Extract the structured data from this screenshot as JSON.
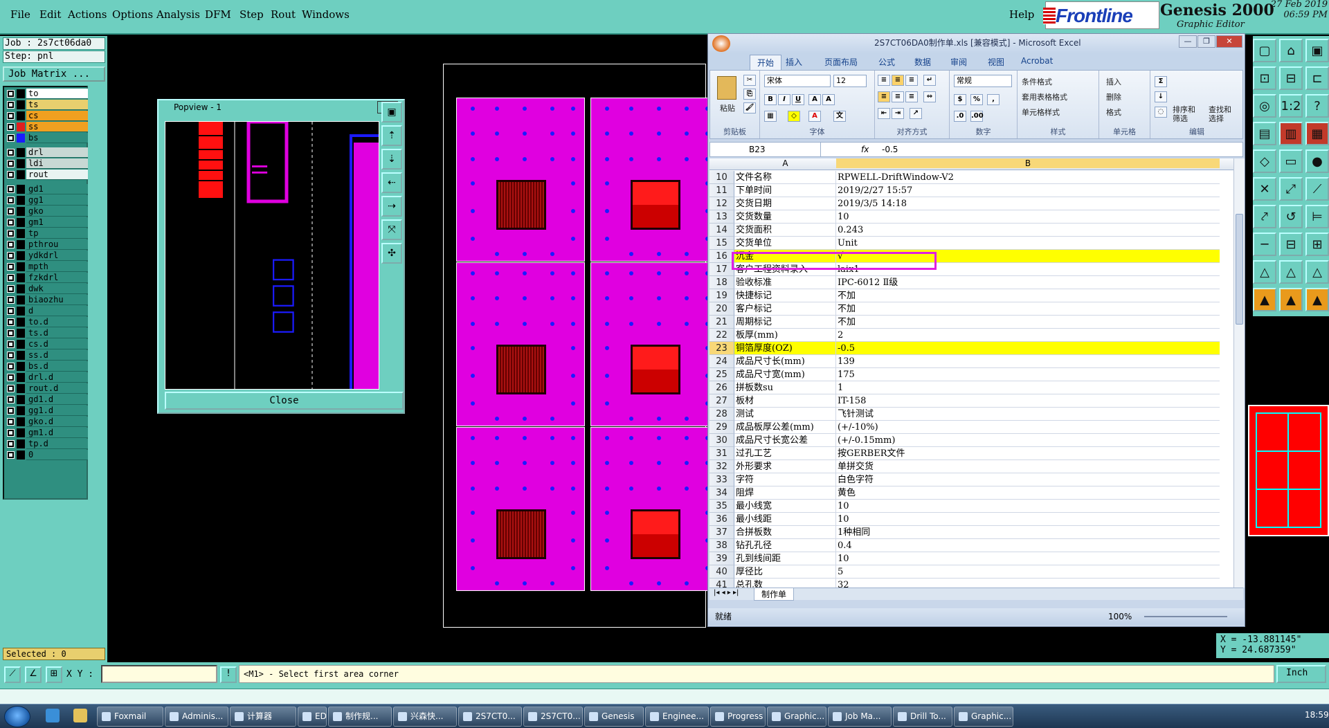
{
  "menu": {
    "items": [
      "File",
      "Edit",
      "Actions",
      "Options",
      "Analysis",
      "DFM",
      "Step",
      "Rout",
      "Windows"
    ],
    "help": "Help"
  },
  "branding": {
    "logo": "Frontline",
    "app_name": "Genesis 2000",
    "subtitle": "Graphic Editor",
    "date": "27 Feb 2019",
    "time": "06:59 PM"
  },
  "job": {
    "job_line": "Job : 2s7ct06da0",
    "step_line": "Step: pnl",
    "matrix_button": "Job Matrix ..."
  },
  "layers": [
    {
      "name": "to",
      "color": "#000000",
      "bg": "#ffffff"
    },
    {
      "name": "ts",
      "color": "#000000",
      "bg": "#e8cf6e"
    },
    {
      "name": "cs",
      "color": "#000000",
      "bg": "#f0a020"
    },
    {
      "name": "ss",
      "color": "#e02020",
      "bg": "#f0a020",
      "active": true
    },
    {
      "name": "bs",
      "color": "#1b1bff",
      "bg": "#2f8f80"
    },
    {
      "name": "drl",
      "color": "#000000",
      "bg": "#c8d8d4"
    },
    {
      "name": "ldi",
      "color": "#000000",
      "bg": "#c8d8d4"
    },
    {
      "name": "rout",
      "color": "#000000",
      "bg": "#e8f4f2"
    },
    {
      "name": "gd1",
      "color": "#000000",
      "bg": "#2f8f80"
    },
    {
      "name": "gg1",
      "color": "#000000",
      "bg": "#2f8f80"
    },
    {
      "name": "gko",
      "color": "#000000",
      "bg": "#2f8f80"
    },
    {
      "name": "gm1",
      "color": "#000000",
      "bg": "#2f8f80"
    },
    {
      "name": "tp",
      "color": "#000000",
      "bg": "#2f8f80"
    },
    {
      "name": "pthrou",
      "color": "#000000",
      "bg": "#2f8f80"
    },
    {
      "name": "ydkdrl",
      "color": "#000000",
      "bg": "#2f8f80"
    },
    {
      "name": "mpth",
      "color": "#000000",
      "bg": "#2f8f80"
    },
    {
      "name": "fzkdrl",
      "color": "#000000",
      "bg": "#2f8f80"
    },
    {
      "name": "dwk",
      "color": "#000000",
      "bg": "#2f8f80"
    },
    {
      "name": "biaozhu",
      "color": "#000000",
      "bg": "#2f8f80"
    },
    {
      "name": "d",
      "color": "#000000",
      "bg": "#2f8f80"
    },
    {
      "name": "to.d",
      "color": "#000000",
      "bg": "#2f8f80"
    },
    {
      "name": "ts.d",
      "color": "#000000",
      "bg": "#2f8f80"
    },
    {
      "name": "cs.d",
      "color": "#000000",
      "bg": "#2f8f80"
    },
    {
      "name": "ss.d",
      "color": "#000000",
      "bg": "#2f8f80"
    },
    {
      "name": "bs.d",
      "color": "#000000",
      "bg": "#2f8f80"
    },
    {
      "name": "drl.d",
      "color": "#000000",
      "bg": "#2f8f80"
    },
    {
      "name": "rout.d",
      "color": "#000000",
      "bg": "#2f8f80"
    },
    {
      "name": "gd1.d",
      "color": "#000000",
      "bg": "#2f8f80"
    },
    {
      "name": "gg1.d",
      "color": "#000000",
      "bg": "#2f8f80"
    },
    {
      "name": "gko.d",
      "color": "#000000",
      "bg": "#2f8f80"
    },
    {
      "name": "gm1.d",
      "color": "#000000",
      "bg": "#2f8f80"
    },
    {
      "name": "tp.d",
      "color": "#000000",
      "bg": "#2f8f80"
    },
    {
      "name": "0",
      "color": "#000000",
      "bg": "#2f8f80"
    }
  ],
  "selected": "Selected : 0",
  "popview": {
    "title": "Popview - 1",
    "close_x": "✕",
    "close_button": "Close"
  },
  "excel": {
    "title": "2S7CT06DA0制作单.xls [兼容模式] - Microsoft Excel",
    "tabs": [
      "开始",
      "插入",
      "页面布局",
      "公式",
      "数据",
      "审阅",
      "视图",
      "Acrobat"
    ],
    "ribbon": {
      "paste": "粘贴",
      "clipboard": "剪贴板",
      "font_name": "宋体",
      "font_size": "12",
      "font_group": "字体",
      "align_group": "对齐方式",
      "number_format": "常规",
      "number_group": "数字",
      "cond_format": "条件格式",
      "table_format": "套用表格格式",
      "cell_style": "单元格样式",
      "style_group": "样式",
      "insert": "插入",
      "delete": "删除",
      "format": "格式",
      "cells_group": "单元格",
      "sort": "排序和筛选",
      "find": "查找和选择",
      "edit_group": "编辑"
    },
    "namebox": "B23",
    "fx": "fx",
    "formula": "-0.5",
    "columns": [
      "A",
      "B"
    ],
    "rows": [
      {
        "n": "10",
        "a": "文件名称",
        "b": "RPWELL-DriftWindow-V2"
      },
      {
        "n": "11",
        "a": "下单时间",
        "b": "2019/2/27 15:57"
      },
      {
        "n": "12",
        "a": "交货日期",
        "b": "2019/3/5 14:18"
      },
      {
        "n": "13",
        "a": "交货数量",
        "b": "10"
      },
      {
        "n": "14",
        "a": "交货面积",
        "b": "0.243"
      },
      {
        "n": "15",
        "a": "交货单位",
        "b": "Unit"
      },
      {
        "n": "16",
        "a": "沉金",
        "b": "√",
        "yellow": true
      },
      {
        "n": "17",
        "a": "客户工程资料录入",
        "b": "laix1"
      },
      {
        "n": "18",
        "a": "验收标准",
        "b": "IPC-6012 Ⅱ级"
      },
      {
        "n": "19",
        "a": "快捷标记",
        "b": "不加"
      },
      {
        "n": "20",
        "a": "客户标记",
        "b": "不加"
      },
      {
        "n": "21",
        "a": "周期标记",
        "b": "不加"
      },
      {
        "n": "22",
        "a": "板厚(mm)",
        "b": "2"
      },
      {
        "n": "23",
        "a": "铜箔厚度(OZ)",
        "b": "-0.5",
        "yellow": true
      },
      {
        "n": "24",
        "a": "成品尺寸长(mm)",
        "b": "139"
      },
      {
        "n": "25",
        "a": "成品尺寸宽(mm)",
        "b": "175"
      },
      {
        "n": "26",
        "a": "拼板数su",
        "b": "1"
      },
      {
        "n": "27",
        "a": "板材",
        "b": "IT-158"
      },
      {
        "n": "28",
        "a": "测试",
        "b": "飞针测试"
      },
      {
        "n": "29",
        "a": "成品板厚公差(mm)",
        "b": "(+/-10%)"
      },
      {
        "n": "30",
        "a": "成品尺寸长宽公差",
        "b": "(+/-0.15mm)"
      },
      {
        "n": "31",
        "a": "过孔工艺",
        "b": "按GERBER文件"
      },
      {
        "n": "32",
        "a": "外形要求",
        "b": "单拼交货"
      },
      {
        "n": "33",
        "a": "字符",
        "b": "白色字符"
      },
      {
        "n": "34",
        "a": "阻焊",
        "b": "黄色"
      },
      {
        "n": "35",
        "a": "最小线宽",
        "b": "10"
      },
      {
        "n": "36",
        "a": "最小线距",
        "b": "10"
      },
      {
        "n": "37",
        "a": "合拼板数",
        "b": "1种相同"
      },
      {
        "n": "38",
        "a": "钻孔孔径",
        "b": "0.4"
      },
      {
        "n": "39",
        "a": "孔到线间距",
        "b": "10"
      },
      {
        "n": "40",
        "a": "厚径比",
        "b": "5"
      },
      {
        "n": "41",
        "a": "总孔数",
        "b": "32"
      }
    ],
    "sheet_tab": "制作单",
    "status": "就绪",
    "zoom": "100%"
  },
  "coords": {
    "x": "X = -13.881145\"",
    "y": "Y = 24.687359\""
  },
  "statusbar": {
    "xy_label": "X Y :",
    "prompt": "<M1> - Select first area corner",
    "unit": "Inch"
  },
  "taskbar": {
    "items": [
      "Foxmail",
      "Adminis...",
      "计算器",
      "EDS工...",
      "制作规...",
      "兴森快...",
      "2S7CT0...",
      "2S7CT0...",
      "Genesis",
      "Enginee...",
      "Progress",
      "Graphic...",
      "Job Ma...",
      "Drill To...",
      "Graphic..."
    ],
    "clock": "18:59"
  }
}
